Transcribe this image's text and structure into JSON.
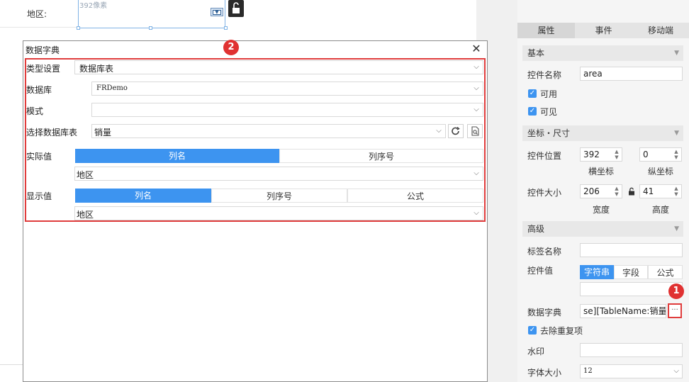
{
  "canvas": {
    "area_label": "地区:",
    "widget_value": "392像素"
  },
  "dialog": {
    "title": "数据字典",
    "close_glyph": "✕",
    "badge": "2",
    "type_label": "类型设置",
    "type_value": "数据库表",
    "db_label": "数据库",
    "db_value": "FRDemo",
    "schema_label": "模式",
    "schema_value": "",
    "table_label": "选择数据库表",
    "table_value": "销量",
    "actual_label": "实际值",
    "actual_tabs": [
      "列名",
      "列序号"
    ],
    "actual_value": "地区",
    "display_label": "显示值",
    "display_tabs": [
      "列名",
      "列序号",
      "公式"
    ],
    "display_value": "地区"
  },
  "panel": {
    "tabs": [
      "属性",
      "事件",
      "移动端"
    ],
    "basic_section": "基本",
    "widget_name_label": "控件名称",
    "widget_name_value": "area",
    "enabled_label": "可用",
    "visible_label": "可见",
    "pos_section": "坐标・尺寸",
    "pos_label": "控件位置",
    "pos_x": "392",
    "pos_y": "0",
    "x_caption": "横坐标",
    "y_caption": "纵坐标",
    "size_label": "控件大小",
    "width": "206",
    "height": "41",
    "width_caption": "宽度",
    "height_caption": "高度",
    "advanced_section": "高级",
    "tag_label": "标签名称",
    "tag_value": "",
    "value_label": "控件值",
    "value_tabs": [
      "字符串",
      "字段",
      "公式"
    ],
    "dict_label": "数据字典",
    "dict_value": "se][TableName:销量]",
    "dict_button": "···",
    "badge": "1",
    "dedupe_label": "去除重复项",
    "watermark_label": "水印",
    "font_size_label": "字体大小",
    "font_size_value": "12"
  },
  "colors": {
    "accent": "#3d94f0",
    "highlight": "#e03c3c"
  }
}
